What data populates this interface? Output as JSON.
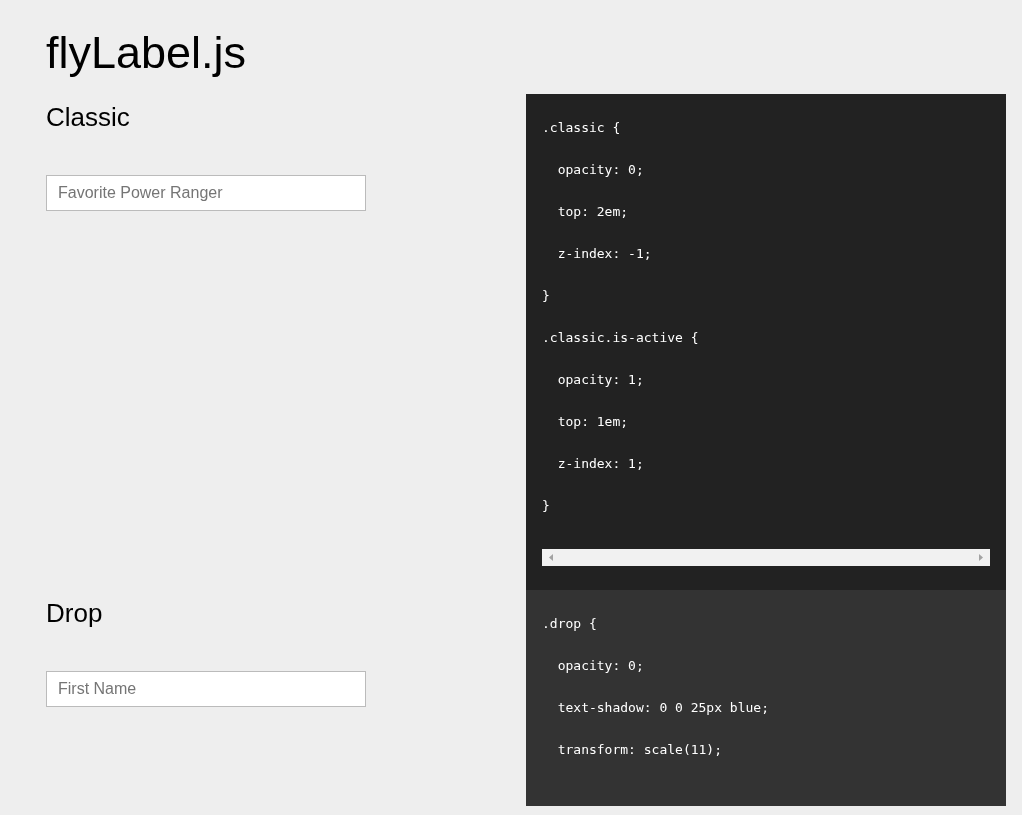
{
  "title": "flyLabel.js",
  "sections": [
    {
      "heading": "Classic",
      "field": {
        "placeholder": "Favorite Power Ranger"
      },
      "code": {
        "kind": "dark",
        "scrollbar": true,
        "lines": [
          ".classic {",
          "  opacity: 0;",
          "  top: 2em;",
          "  z-index: -1;",
          "}",
          ".classic.is-active {",
          "  opacity: 1;",
          "  top: 1em;",
          "  z-index: 1;",
          "}"
        ]
      }
    },
    {
      "heading": "Drop",
      "field": {
        "placeholder": "First Name"
      },
      "code": {
        "kind": "medium",
        "scrollbar": false,
        "lines": [
          ".drop {",
          "  opacity: 0;",
          "  text-shadow: 0 0 25px blue;",
          "  transform: scale(11);"
        ]
      }
    }
  ]
}
